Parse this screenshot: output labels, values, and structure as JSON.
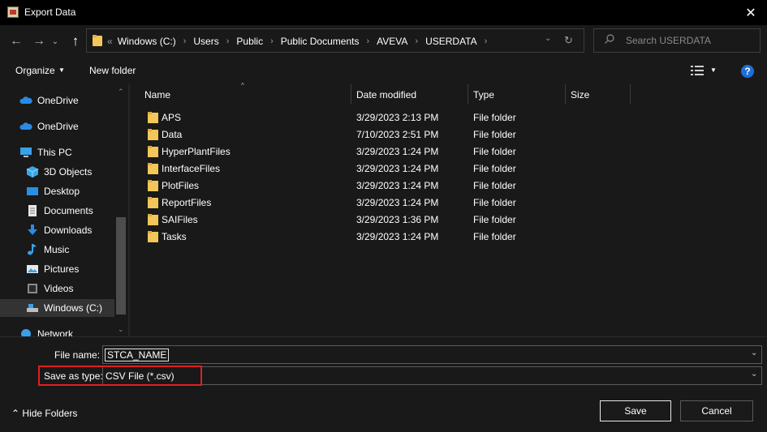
{
  "window": {
    "title": "Export Data",
    "close_label": "✕"
  },
  "nav": {
    "back_label": "←",
    "forward_label": "→",
    "recent_label": "⌄",
    "up_label": "↑",
    "overflow": "«",
    "breadcrumbs": [
      "Windows (C:)",
      "Users",
      "Public",
      "Public Documents",
      "AVEVA",
      "USERDATA"
    ],
    "crumb_separator": "›",
    "dropdown_label": "⌄",
    "refresh_label": "↻",
    "search_placeholder": "Search USERDATA"
  },
  "toolbar": {
    "organize_label": "Organize",
    "caret": "▼",
    "new_folder_label": "New folder",
    "help_label": "?"
  },
  "sidebar": {
    "scroll_up": "⌃",
    "scroll_down": "⌄",
    "items": [
      {
        "label": "OneDrive",
        "icon": "cloud-icon"
      },
      {
        "label": "OneDrive",
        "icon": "cloud-icon"
      },
      {
        "label": "This PC",
        "icon": "computer-icon"
      },
      {
        "label": "3D Objects",
        "icon": "cube-icon"
      },
      {
        "label": "Desktop",
        "icon": "desktop-icon"
      },
      {
        "label": "Documents",
        "icon": "documents-icon"
      },
      {
        "label": "Downloads",
        "icon": "download-icon"
      },
      {
        "label": "Music",
        "icon": "music-icon"
      },
      {
        "label": "Pictures",
        "icon": "pictures-icon"
      },
      {
        "label": "Videos",
        "icon": "videos-icon"
      },
      {
        "label": "Windows (C:)",
        "icon": "drive-icon",
        "selected": true
      },
      {
        "label": "Network",
        "icon": "network-icon"
      }
    ]
  },
  "file_list": {
    "sort_indicator": "^",
    "columns": [
      "Name",
      "Date modified",
      "Type",
      "Size"
    ],
    "rows": [
      {
        "name": "APS",
        "date": "3/29/2023 2:13 PM",
        "type": "File folder"
      },
      {
        "name": "Data",
        "date": "7/10/2023 2:51 PM",
        "type": "File folder"
      },
      {
        "name": "HyperPlantFiles",
        "date": "3/29/2023 1:24 PM",
        "type": "File folder"
      },
      {
        "name": "InterfaceFiles",
        "date": "3/29/2023 1:24 PM",
        "type": "File folder"
      },
      {
        "name": "PlotFiles",
        "date": "3/29/2023 1:24 PM",
        "type": "File folder"
      },
      {
        "name": "ReportFiles",
        "date": "3/29/2023 1:24 PM",
        "type": "File folder"
      },
      {
        "name": "SAIFiles",
        "date": "3/29/2023 1:36 PM",
        "type": "File folder"
      },
      {
        "name": "Tasks",
        "date": "3/29/2023 1:24 PM",
        "type": "File folder"
      }
    ]
  },
  "form": {
    "file_name_label": "File name:",
    "file_name_value": "STCA_NAME",
    "save_type_label": "Save as type:",
    "save_type_value": "CSV File (*.csv)",
    "dropdown_label": "⌄"
  },
  "footer": {
    "hide_folders_label": "Hide Folders",
    "hide_caret": "⌃",
    "save_label": "Save",
    "cancel_label": "Cancel"
  },
  "colors": {
    "background": "#191919",
    "titlebar": "#000000",
    "folder": "#f3c65a",
    "highlight": "#e02020",
    "help": "#1e6fd9"
  }
}
